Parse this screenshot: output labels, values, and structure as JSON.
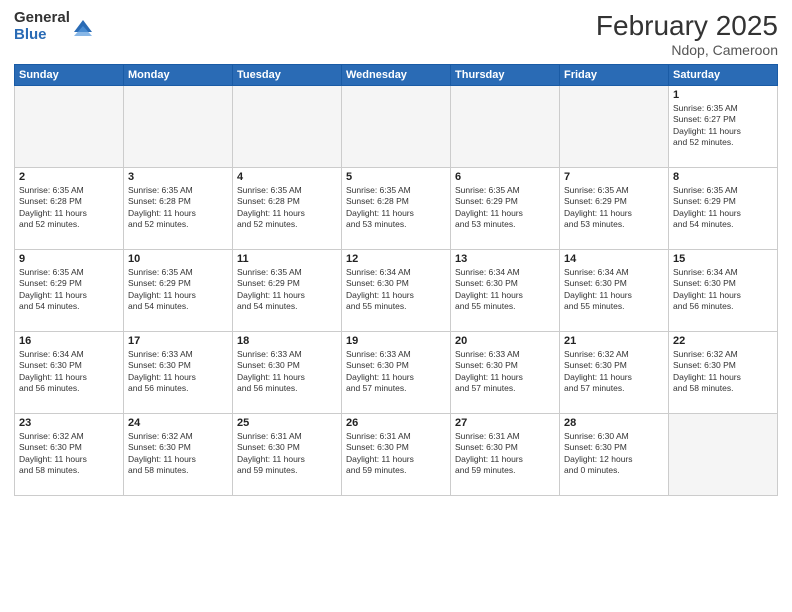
{
  "header": {
    "logo_general": "General",
    "logo_blue": "Blue",
    "month_title": "February 2025",
    "location": "Ndop, Cameroon"
  },
  "days_of_week": [
    "Sunday",
    "Monday",
    "Tuesday",
    "Wednesday",
    "Thursday",
    "Friday",
    "Saturday"
  ],
  "weeks": [
    [
      {
        "day": "",
        "info": ""
      },
      {
        "day": "",
        "info": ""
      },
      {
        "day": "",
        "info": ""
      },
      {
        "day": "",
        "info": ""
      },
      {
        "day": "",
        "info": ""
      },
      {
        "day": "",
        "info": ""
      },
      {
        "day": "1",
        "info": "Sunrise: 6:35 AM\nSunset: 6:27 PM\nDaylight: 11 hours\nand 52 minutes."
      }
    ],
    [
      {
        "day": "2",
        "info": "Sunrise: 6:35 AM\nSunset: 6:28 PM\nDaylight: 11 hours\nand 52 minutes."
      },
      {
        "day": "3",
        "info": "Sunrise: 6:35 AM\nSunset: 6:28 PM\nDaylight: 11 hours\nand 52 minutes."
      },
      {
        "day": "4",
        "info": "Sunrise: 6:35 AM\nSunset: 6:28 PM\nDaylight: 11 hours\nand 52 minutes."
      },
      {
        "day": "5",
        "info": "Sunrise: 6:35 AM\nSunset: 6:28 PM\nDaylight: 11 hours\nand 53 minutes."
      },
      {
        "day": "6",
        "info": "Sunrise: 6:35 AM\nSunset: 6:29 PM\nDaylight: 11 hours\nand 53 minutes."
      },
      {
        "day": "7",
        "info": "Sunrise: 6:35 AM\nSunset: 6:29 PM\nDaylight: 11 hours\nand 53 minutes."
      },
      {
        "day": "8",
        "info": "Sunrise: 6:35 AM\nSunset: 6:29 PM\nDaylight: 11 hours\nand 54 minutes."
      }
    ],
    [
      {
        "day": "9",
        "info": "Sunrise: 6:35 AM\nSunset: 6:29 PM\nDaylight: 11 hours\nand 54 minutes."
      },
      {
        "day": "10",
        "info": "Sunrise: 6:35 AM\nSunset: 6:29 PM\nDaylight: 11 hours\nand 54 minutes."
      },
      {
        "day": "11",
        "info": "Sunrise: 6:35 AM\nSunset: 6:29 PM\nDaylight: 11 hours\nand 54 minutes."
      },
      {
        "day": "12",
        "info": "Sunrise: 6:34 AM\nSunset: 6:30 PM\nDaylight: 11 hours\nand 55 minutes."
      },
      {
        "day": "13",
        "info": "Sunrise: 6:34 AM\nSunset: 6:30 PM\nDaylight: 11 hours\nand 55 minutes."
      },
      {
        "day": "14",
        "info": "Sunrise: 6:34 AM\nSunset: 6:30 PM\nDaylight: 11 hours\nand 55 minutes."
      },
      {
        "day": "15",
        "info": "Sunrise: 6:34 AM\nSunset: 6:30 PM\nDaylight: 11 hours\nand 56 minutes."
      }
    ],
    [
      {
        "day": "16",
        "info": "Sunrise: 6:34 AM\nSunset: 6:30 PM\nDaylight: 11 hours\nand 56 minutes."
      },
      {
        "day": "17",
        "info": "Sunrise: 6:33 AM\nSunset: 6:30 PM\nDaylight: 11 hours\nand 56 minutes."
      },
      {
        "day": "18",
        "info": "Sunrise: 6:33 AM\nSunset: 6:30 PM\nDaylight: 11 hours\nand 56 minutes."
      },
      {
        "day": "19",
        "info": "Sunrise: 6:33 AM\nSunset: 6:30 PM\nDaylight: 11 hours\nand 57 minutes."
      },
      {
        "day": "20",
        "info": "Sunrise: 6:33 AM\nSunset: 6:30 PM\nDaylight: 11 hours\nand 57 minutes."
      },
      {
        "day": "21",
        "info": "Sunrise: 6:32 AM\nSunset: 6:30 PM\nDaylight: 11 hours\nand 57 minutes."
      },
      {
        "day": "22",
        "info": "Sunrise: 6:32 AM\nSunset: 6:30 PM\nDaylight: 11 hours\nand 58 minutes."
      }
    ],
    [
      {
        "day": "23",
        "info": "Sunrise: 6:32 AM\nSunset: 6:30 PM\nDaylight: 11 hours\nand 58 minutes."
      },
      {
        "day": "24",
        "info": "Sunrise: 6:32 AM\nSunset: 6:30 PM\nDaylight: 11 hours\nand 58 minutes."
      },
      {
        "day": "25",
        "info": "Sunrise: 6:31 AM\nSunset: 6:30 PM\nDaylight: 11 hours\nand 59 minutes."
      },
      {
        "day": "26",
        "info": "Sunrise: 6:31 AM\nSunset: 6:30 PM\nDaylight: 11 hours\nand 59 minutes."
      },
      {
        "day": "27",
        "info": "Sunrise: 6:31 AM\nSunset: 6:30 PM\nDaylight: 11 hours\nand 59 minutes."
      },
      {
        "day": "28",
        "info": "Sunrise: 6:30 AM\nSunset: 6:30 PM\nDaylight: 12 hours\nand 0 minutes."
      },
      {
        "day": "",
        "info": ""
      }
    ]
  ]
}
